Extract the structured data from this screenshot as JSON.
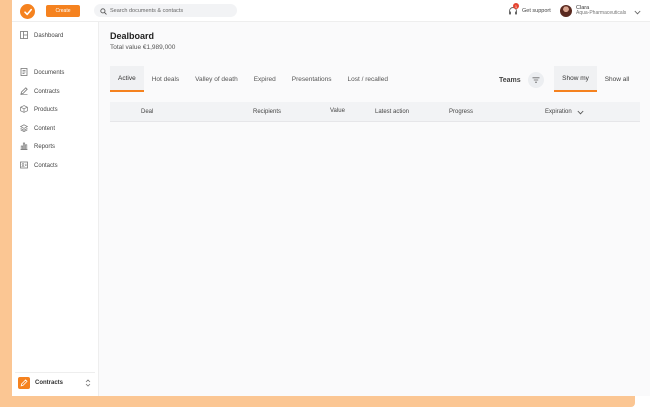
{
  "topbar": {
    "create_label": "Create",
    "search_placeholder": "Search documents & contacts",
    "support_label": "Get support",
    "support_badge": "1",
    "user_name": "Clara",
    "user_org": "Aqua-Pharmaceuticals"
  },
  "sidebar": {
    "items": [
      {
        "label": "Dashboard",
        "icon": "dashboard-icon"
      },
      {
        "label": "Documents",
        "icon": "document-icon"
      },
      {
        "label": "Contracts",
        "icon": "pen-icon"
      },
      {
        "label": "Products",
        "icon": "box-icon"
      },
      {
        "label": "Content",
        "icon": "layers-icon"
      },
      {
        "label": "Reports",
        "icon": "bar-chart-icon"
      },
      {
        "label": "Contacts",
        "icon": "contact-card-icon"
      }
    ],
    "footer_label": "Contracts"
  },
  "main": {
    "title": "Dealboard",
    "total_value": "Total value €1,989,000",
    "tabs": [
      "Active",
      "Hot deals",
      "Valley of death",
      "Expired",
      "Presentations",
      "Lost / recalled"
    ],
    "active_tab": "Active",
    "teams_label": "Teams",
    "show_my_label": "Show my",
    "show_all_label": "Show all",
    "columns": [
      "Deal",
      "Recipients",
      "Value",
      "Latest action",
      "Progress",
      "Expiration"
    ]
  },
  "colors": {
    "accent": "#f5821f",
    "frame": "#fbc693",
    "badge": "#e5432f"
  }
}
